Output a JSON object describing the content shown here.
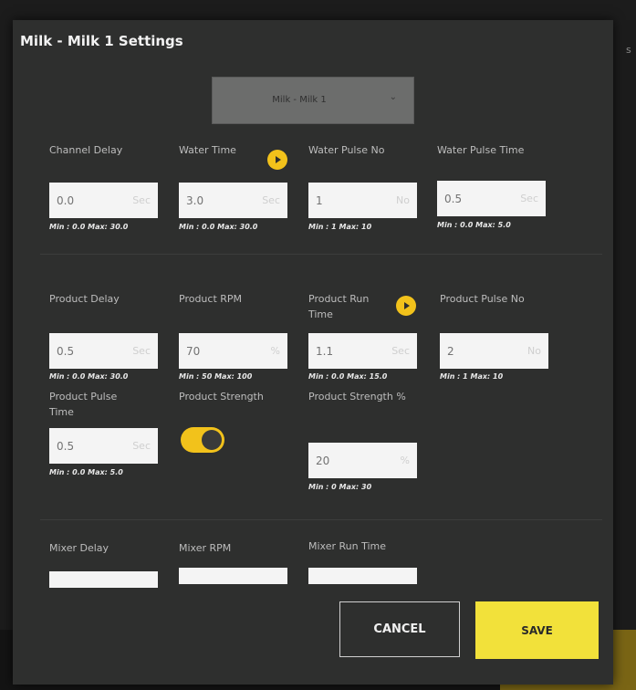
{
  "background": {
    "edge_text": "s"
  },
  "dialog": {
    "title": "Milk - Milk 1 Settings",
    "selector": {
      "value": "Milk - Milk 1",
      "icon": "chevron-down-icon"
    },
    "sections": [
      {
        "fields": [
          {
            "label": "Channel Delay",
            "value": "0.0",
            "unit": "Sec",
            "hint": "Min : 0.0 Max: 30.0",
            "info_icon": false
          },
          {
            "label": "Water Time",
            "value": "3.0",
            "unit": "Sec",
            "hint": "Min : 0.0 Max: 30.0",
            "info_icon": true
          },
          {
            "label": "Water Pulse No",
            "value": "1",
            "unit": "No",
            "hint": "Min : 1 Max: 10",
            "info_icon": false
          },
          {
            "label": "Water Pulse Time",
            "value": "0.5",
            "unit": "Sec",
            "hint": "Min : 0.0 Max: 5.0",
            "info_icon": false
          }
        ]
      },
      {
        "fields": [
          {
            "label": "Product Delay",
            "value": "0.5",
            "unit": "Sec",
            "hint": "Min : 0.0 Max: 30.0",
            "info_icon": false
          },
          {
            "label": "Product RPM",
            "value": "70",
            "unit": "%",
            "hint": "Min : 50 Max: 100",
            "info_icon": false
          },
          {
            "label": "Product Run Time",
            "value": "1.1",
            "unit": "Sec",
            "hint": "Min : 0.0 Max: 15.0",
            "info_icon": true
          },
          {
            "label": "Product Pulse No",
            "value": "2",
            "unit": "No",
            "hint": "Min : 1 Max: 10",
            "info_icon": false
          },
          {
            "label": "Product Pulse Time",
            "value": "0.5",
            "unit": "Sec",
            "hint": "Min : 0.0 Max: 5.0",
            "info_icon": false
          },
          {
            "label": "Product Strength",
            "toggle": true,
            "toggle_on": true
          },
          {
            "label": "Product Strength %",
            "value": "20",
            "unit": "%",
            "hint": "Min : 0 Max: 30",
            "info_icon": false
          }
        ]
      },
      {
        "fields": [
          {
            "label": "Mixer Delay"
          },
          {
            "label": "Mixer RPM"
          },
          {
            "label": "Mixer Run Time"
          }
        ]
      }
    ],
    "buttons": {
      "cancel": "CANCEL",
      "save": "SAVE"
    },
    "colors": {
      "accent": "#f2c21b",
      "save_button": "#f2e13a",
      "dialog_bg": "#2e2f2e"
    }
  }
}
